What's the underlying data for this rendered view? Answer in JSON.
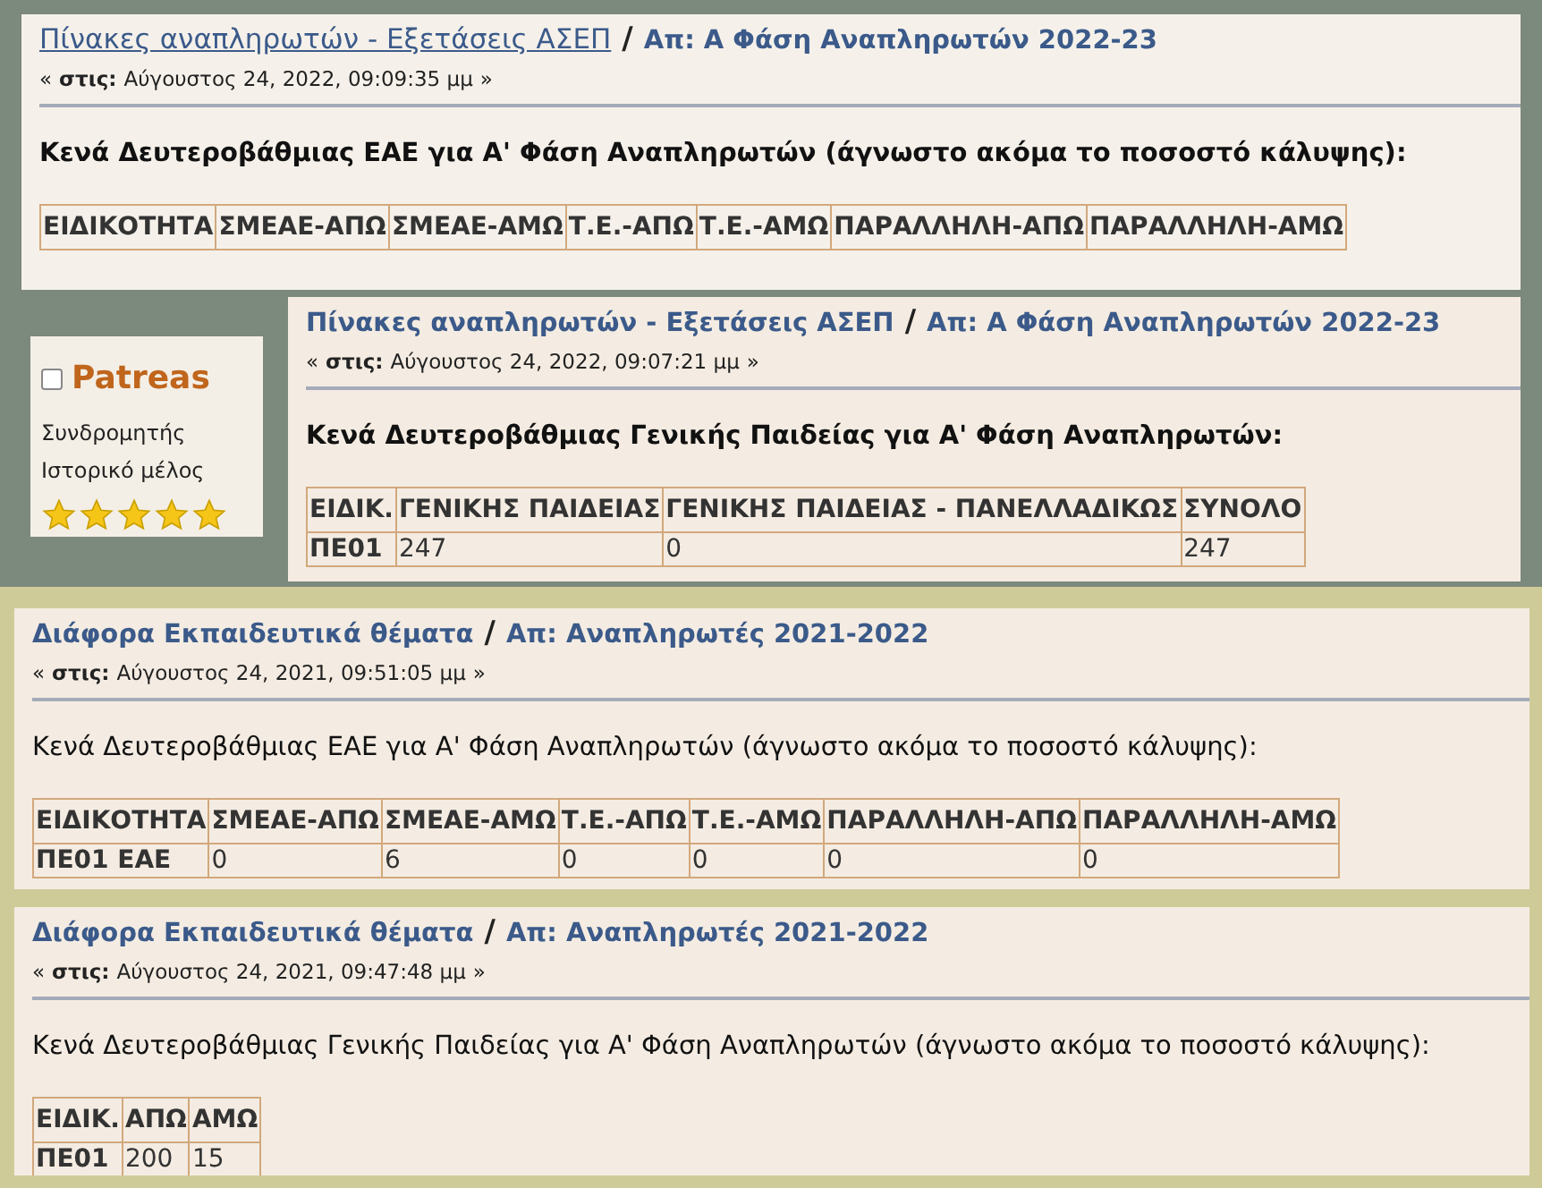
{
  "posts": [
    {
      "kind": "gray",
      "board": "Πίνακες αναπληρωτών - Εξετάσεις ΑΣΕΠ",
      "board_underlined": true,
      "separator": "/",
      "topic": "Απ: Α Φάση Αναπληρωτών 2022-23",
      "date_prefix": "«",
      "date_label": "στις:",
      "date": "Αύγουστος 24, 2022, 09:09:35 μμ",
      "date_suffix": "»",
      "heading": "Κενά Δευτεροβάθμιας ΕΑΕ για Α' Φάση Αναπληρωτών (άγνωστο ακόμα το ποσοστό κάλυψης):",
      "heading_bold": true,
      "table": {
        "columns": [
          "ΕΙΔΙΚΟΤΗΤΑ",
          "ΣΜΕΑΕ-ΑΠΩ",
          "ΣΜΕΑΕ-ΑΜΩ",
          "Τ.Ε.-ΑΠΩ",
          "Τ.Ε.-ΑΜΩ",
          "ΠΑΡΑΛΛΗΛΗ-ΑΠΩ",
          "ΠΑΡΑΛΛΗΛΗ-ΑΜΩ"
        ]
      }
    },
    {
      "kind": "gray",
      "user": {
        "checked": false,
        "name": "Patreas",
        "role": "Συνδρομητής",
        "rank": "Ιστορικό μέλος",
        "stars": 5
      },
      "board": "Πίνακες αναπληρωτών - Εξετάσεις ΑΣΕΠ",
      "board_underlined": false,
      "separator": "/",
      "topic": "Απ: Α Φάση Αναπληρωτών 2022-23",
      "date_prefix": "«",
      "date_label": "στις:",
      "date": "Αύγουστος 24, 2022, 09:07:21 μμ",
      "date_suffix": "»",
      "heading": "Κενά Δευτεροβάθμιας Γενικής Παιδείας για Α' Φάση Αναπληρωτών:",
      "heading_bold": true,
      "table": {
        "columns": [
          "ΕΙΔΙΚ.",
          "ΓΕΝΙΚΗΣ ΠΑΙΔΕΙΑΣ",
          "ΓΕΝΙΚΗΣ ΠΑΙΔΕΙΑΣ - ΠΑΝΕΛΛΑΔΙΚΩΣ",
          "ΣΥΝΟΛΟ"
        ],
        "rows": [
          [
            "ΠΕ01",
            "247",
            "0",
            "247"
          ]
        ]
      }
    },
    {
      "kind": "olive",
      "board": "Διάφορα Εκπαιδευτικά θέματα",
      "board_underlined": false,
      "separator": "/",
      "topic": "Απ: Αναπληρωτές 2021-2022",
      "date_prefix": "«",
      "date_label": "στις:",
      "date": "Αύγουστος 24, 2021, 09:51:05 μμ",
      "date_suffix": "»",
      "heading": "Κενά Δευτεροβάθμιας ΕΑΕ για Α' Φάση Αναπληρωτών (άγνωστο ακόμα το ποσοστό κάλυψης):",
      "heading_bold": false,
      "table": {
        "columns": [
          "ΕΙΔΙΚΟΤΗΤΑ",
          "ΣΜΕΑΕ-ΑΠΩ",
          "ΣΜΕΑΕ-ΑΜΩ",
          "Τ.Ε.-ΑΠΩ",
          "Τ.Ε.-ΑΜΩ",
          "ΠΑΡΑΛΛΗΛΗ-ΑΠΩ",
          "ΠΑΡΑΛΛΗΛΗ-ΑΜΩ"
        ],
        "rows": [
          [
            "ΠΕ01 ΕΑΕ",
            "0",
            "6",
            "0",
            "0",
            "0",
            "0"
          ]
        ]
      }
    },
    {
      "kind": "olive",
      "board": "Διάφορα Εκπαιδευτικά θέματα",
      "board_underlined": false,
      "separator": "/",
      "topic": "Απ: Αναπληρωτές 2021-2022",
      "date_prefix": "«",
      "date_label": "στις:",
      "date": "Αύγουστος 24, 2021, 09:47:48 μμ",
      "date_suffix": "»",
      "heading": "Κενά Δευτεροβάθμιας Γενικής Παιδείας για Α' Φάση Αναπληρωτών (άγνωστο ακόμα το ποσοστό κάλυψης):",
      "heading_bold": false,
      "table": {
        "columns": [
          "ΕΙΔΙΚ.",
          "ΑΠΩ",
          "ΑΜΩ"
        ],
        "rows": [
          [
            "ΠΕ01",
            "200",
            "15"
          ]
        ]
      }
    }
  ]
}
